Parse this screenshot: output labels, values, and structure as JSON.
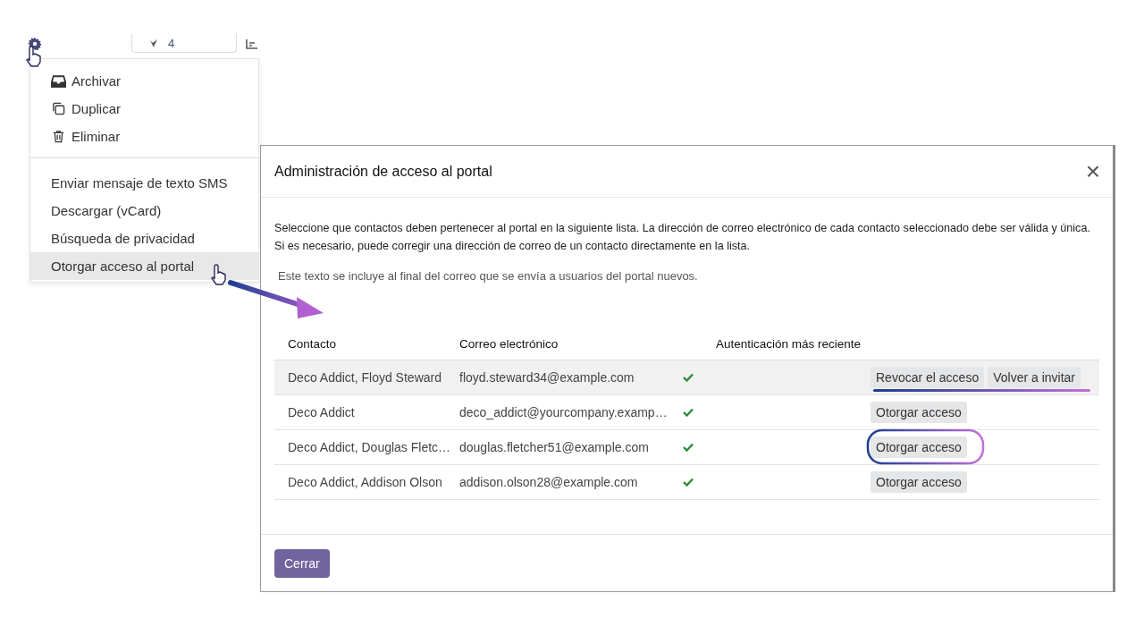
{
  "toolbar": {
    "count": "4"
  },
  "menu": {
    "groups": [
      {
        "items": [
          {
            "label": "Archivar",
            "selected": false
          },
          {
            "label": "Duplicar",
            "selected": false
          },
          {
            "label": "Eliminar",
            "selected": false
          }
        ]
      },
      {
        "items": [
          {
            "label": "Enviar mensaje de texto SMS",
            "selected": false
          },
          {
            "label": "Descargar (vCard)",
            "selected": false
          },
          {
            "label": "Búsqueda de privacidad",
            "selected": false
          },
          {
            "label": "Otorgar acceso al portal",
            "selected": true
          }
        ]
      }
    ]
  },
  "dialog": {
    "title": "Administración de acceso al portal",
    "close": "×",
    "intro": "Seleccione que contactos deben pertenecer al portal en la siguiente lista. La dirección de correo electrónico de cada contacto seleccionado debe ser válida y única. Si es necesario, puede corregir una dirección de correo de un contacto directamente en la lista.",
    "note": "Este texto se incluye al final del correo que se envía a usuarios del portal nuevos.",
    "table": {
      "columns": [
        "Contacto",
        "Correo electrónico",
        "Autenticación más reciente"
      ],
      "rows": [
        {
          "contact": "Deco Addict, Floyd Steward",
          "email": "floyd.steward34@example.com",
          "valid": true,
          "selected": true,
          "actions": [
            "Revocar el acceso",
            "Volver a invitar"
          ]
        },
        {
          "contact": "Deco Addict",
          "email": "deco_addict@yourcompany.examp…",
          "valid": true,
          "selected": false,
          "actions": [
            "Otorgar acceso"
          ]
        },
        {
          "contact": "Deco Addict, Douglas Fletc…",
          "email": "douglas.fletcher51@example.com",
          "valid": true,
          "selected": false,
          "actions": [
            "Otorgar acceso"
          ]
        },
        {
          "contact": "Deco Addict, Addison Olson",
          "email": "addison.olson28@example.com",
          "valid": true,
          "selected": false,
          "actions": [
            "Otorgar acceso"
          ]
        }
      ]
    },
    "footer_button": "Cerrar"
  }
}
